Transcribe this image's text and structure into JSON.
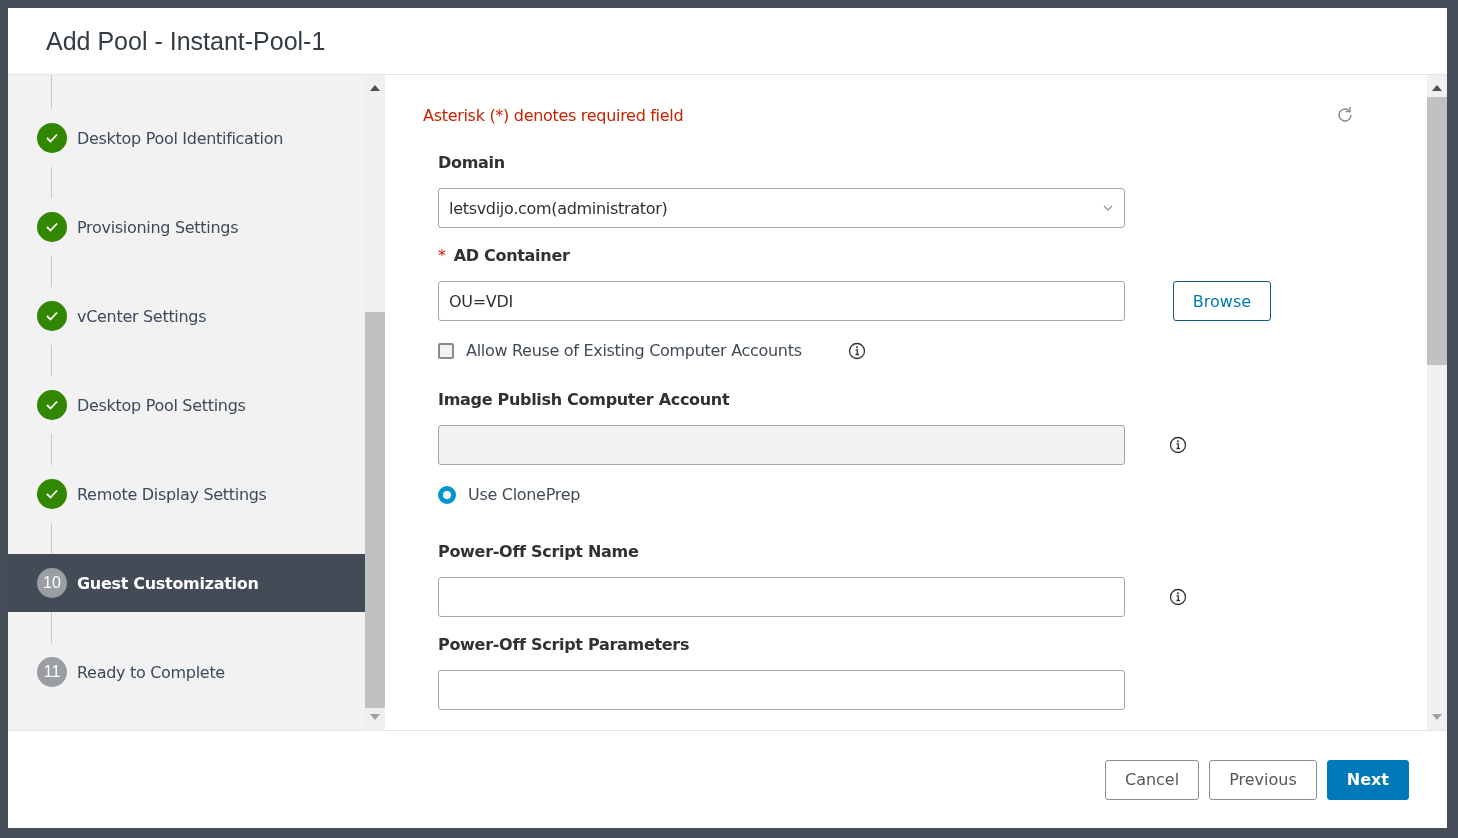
{
  "dialog": {
    "title": "Add Pool - Instant-Pool-1"
  },
  "steps": [
    {
      "label": "Desktop Pool Identification",
      "completed": true,
      "selected": false
    },
    {
      "label": "Provisioning Settings",
      "completed": true,
      "selected": false
    },
    {
      "label": "vCenter Settings",
      "completed": true,
      "selected": false
    },
    {
      "label": "Desktop Pool Settings",
      "completed": true,
      "selected": false
    },
    {
      "label": "Remote Display Settings",
      "completed": true,
      "selected": false
    },
    {
      "number": "10",
      "label": "Guest Customization",
      "completed": false,
      "selected": true
    },
    {
      "number": "11",
      "label": "Ready to Complete",
      "completed": false,
      "selected": false
    }
  ],
  "form": {
    "note": "Asterisk (*) denotes required field",
    "fields": [
      {
        "kind": "select",
        "label": "Domain",
        "value": "letsvdijo.com(administrator)"
      },
      {
        "kind": "browse",
        "marker": "*",
        "label": "AD Container",
        "value": "OU=VDI",
        "button": "Browse"
      },
      {
        "kind": "checkbox",
        "label": "Allow Reuse of Existing Computer Accounts",
        "checked": false,
        "info": true
      },
      {
        "kind": "text",
        "label": "Image Publish Computer Account",
        "disabled": true,
        "info": true
      },
      {
        "kind": "radio",
        "label": "Use ClonePrep",
        "selected": true
      },
      {
        "kind": "text",
        "label": "Power-Off Script Name",
        "info": true
      },
      {
        "kind": "text",
        "label": "Power-Off Script Parameters"
      }
    ]
  },
  "footer": {
    "buttons": [
      {
        "label": "Cancel",
        "kind": "secondary"
      },
      {
        "label": "Previous",
        "kind": "secondary"
      },
      {
        "label": "Next",
        "kind": "primary"
      }
    ]
  }
}
